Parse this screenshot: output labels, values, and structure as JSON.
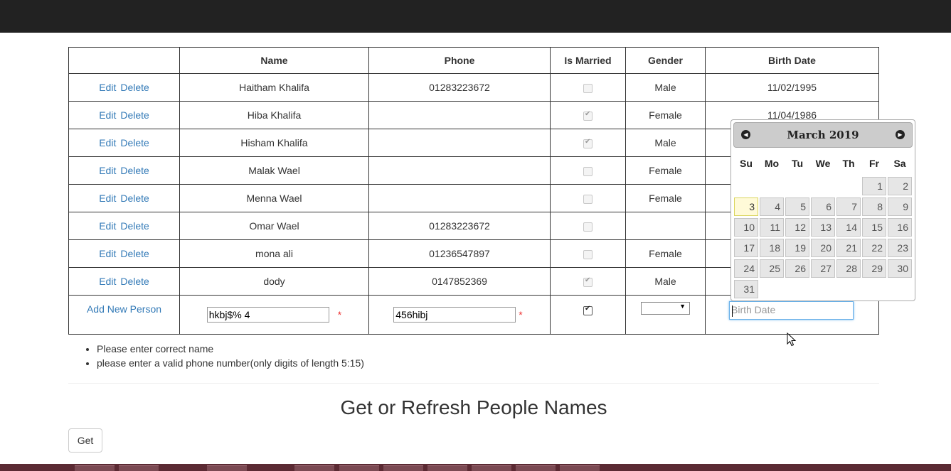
{
  "table": {
    "headers": [
      "",
      "Name",
      "Phone",
      "Is Married",
      "Gender",
      "Birth Date"
    ],
    "edit_label": "Edit",
    "delete_label": "Delete",
    "rows": [
      {
        "name": "Haitham Khalifa",
        "phone": "01283223672",
        "married": false,
        "gender": "Male",
        "birth": "11/02/1995"
      },
      {
        "name": "Hiba Khalifa",
        "phone": "",
        "married": true,
        "gender": "Female",
        "birth": "11/04/1986"
      },
      {
        "name": "Hisham Khalifa",
        "phone": "",
        "married": true,
        "gender": "Male",
        "birth": ""
      },
      {
        "name": "Malak Wael",
        "phone": "",
        "married": false,
        "gender": "Female",
        "birth": ""
      },
      {
        "name": "Menna Wael",
        "phone": "",
        "married": false,
        "gender": "Female",
        "birth": ""
      },
      {
        "name": "Omar Wael",
        "phone": "01283223672",
        "married": false,
        "gender": "",
        "birth": ""
      },
      {
        "name": "mona ali",
        "phone": "01236547897",
        "married": false,
        "gender": "Female",
        "birth": ""
      },
      {
        "name": "dody",
        "phone": "0147852369",
        "married": true,
        "gender": "Male",
        "birth": ""
      }
    ]
  },
  "add_row": {
    "add_label": "Add New Person",
    "name_value": "hkbj$% 4",
    "phone_value": "456hibj",
    "required_marker": "*",
    "married_checked": true,
    "gender_value": "",
    "birth_placeholder": "Birth Date"
  },
  "datepicker": {
    "title": "March 2019",
    "weekdays": [
      "Su",
      "Mo",
      "Tu",
      "We",
      "Th",
      "Fr",
      "Sa"
    ],
    "first_weekday_index": 5,
    "days_in_month": 31,
    "today": 3
  },
  "errors": [
    "Please enter correct name",
    "please enter a valid phone number(only digits of length 5:15)"
  ],
  "section": {
    "title": "Get or Refresh People Names",
    "get_button": "Get"
  }
}
